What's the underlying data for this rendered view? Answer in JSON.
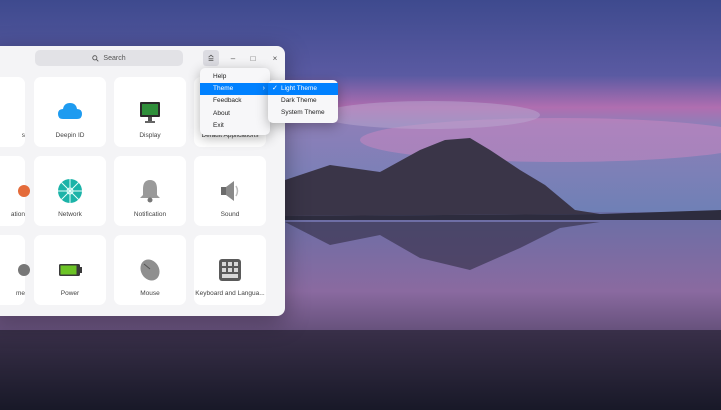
{
  "search": {
    "label": "Search"
  },
  "titlebar": {
    "menu_icon": "menu-icon",
    "minimize_icon": "minimize-icon",
    "maximize_icon": "maximize-icon",
    "close_icon": "close-icon",
    "minimize_glyph": "–",
    "maximize_glyph": "□",
    "close_glyph": "×"
  },
  "modules": [
    {
      "label": "s",
      "icon": "accounts-icon"
    },
    {
      "label": "Deepin ID",
      "icon": "cloud-icon"
    },
    {
      "label": "Display",
      "icon": "display-icon"
    },
    {
      "label": "Default Applications",
      "icon": "default-apps-icon"
    },
    {
      "label": "ation",
      "icon": "location-icon"
    },
    {
      "label": "Network",
      "icon": "network-icon"
    },
    {
      "label": "Notification",
      "icon": "bell-icon"
    },
    {
      "label": "Sound",
      "icon": "speaker-icon"
    },
    {
      "label": "me",
      "icon": "datetime-icon"
    },
    {
      "label": "Power",
      "icon": "battery-icon"
    },
    {
      "label": "Mouse",
      "icon": "mouse-icon"
    },
    {
      "label": "Keyboard and Langua...",
      "icon": "keyboard-icon"
    }
  ],
  "main_menu": {
    "items": [
      {
        "label": "Help"
      },
      {
        "label": "Theme",
        "selected": true,
        "has_submenu": true
      },
      {
        "label": "Feedback"
      },
      {
        "label": "About"
      },
      {
        "label": "Exit"
      }
    ],
    "submenu_arrow": "›"
  },
  "theme_menu": {
    "items": [
      {
        "label": "Light Theme",
        "checked": true
      },
      {
        "label": "Dark Theme"
      },
      {
        "label": "System Theme"
      }
    ],
    "check_glyph": "✓"
  },
  "colors": {
    "accent": "#0081ff",
    "window_bg": "#f4f4f6",
    "tile_bg": "#ffffff"
  }
}
